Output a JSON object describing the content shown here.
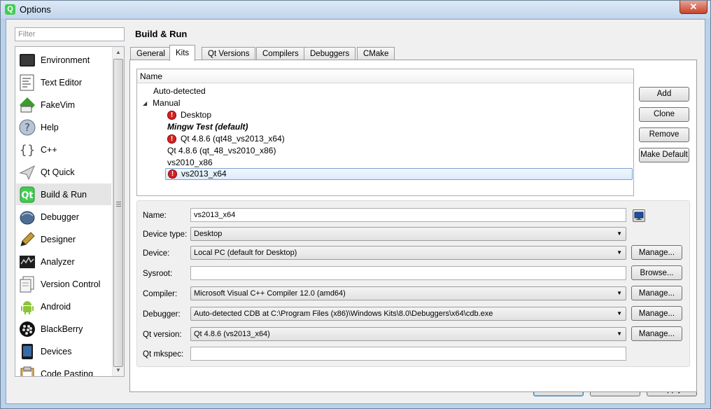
{
  "window": {
    "title": "Options",
    "app_icon_glyph": "Q",
    "close_glyph": "✕"
  },
  "filter": {
    "placeholder": "Filter",
    "value": ""
  },
  "categories": [
    {
      "label": "Environment",
      "icon": "environment-icon"
    },
    {
      "label": "Text Editor",
      "icon": "text-editor-icon"
    },
    {
      "label": "FakeVim",
      "icon": "fakevim-icon"
    },
    {
      "label": "Help",
      "icon": "help-icon"
    },
    {
      "label": "C++",
      "icon": "cpp-icon"
    },
    {
      "label": "Qt Quick",
      "icon": "qt-quick-icon"
    },
    {
      "label": "Build & Run",
      "icon": "build-run-icon",
      "selected": true
    },
    {
      "label": "Debugger",
      "icon": "debugger-icon"
    },
    {
      "label": "Designer",
      "icon": "designer-icon"
    },
    {
      "label": "Analyzer",
      "icon": "analyzer-icon"
    },
    {
      "label": "Version Control",
      "icon": "version-control-icon"
    },
    {
      "label": "Android",
      "icon": "android-icon"
    },
    {
      "label": "BlackBerry",
      "icon": "blackberry-icon"
    },
    {
      "label": "Devices",
      "icon": "devices-icon"
    },
    {
      "label": "Code Pasting",
      "icon": "code-pasting-icon"
    }
  ],
  "page": {
    "title": "Build & Run",
    "tabs": [
      "General",
      "Kits",
      "Qt Versions",
      "Compilers",
      "Debuggers",
      "CMake"
    ],
    "active_tab": "Kits"
  },
  "kits": {
    "header": "Name",
    "groups": {
      "auto_detected": "Auto-detected",
      "manual": "Manual"
    },
    "items": [
      {
        "label": "Desktop",
        "error": true
      },
      {
        "label": "Mingw Test (default)",
        "error": false,
        "default": true
      },
      {
        "label": "Qt 4.8.6 (qt48_vs2013_x64)",
        "error": true
      },
      {
        "label": "Qt 4.8.6 (qt_48_vs2010_x86)",
        "error": false
      },
      {
        "label": "vs2010_x86",
        "error": false
      },
      {
        "label": "vs2013_x64",
        "error": true,
        "selected": true
      }
    ],
    "buttons": {
      "add": "Add",
      "clone": "Clone",
      "remove": "Remove",
      "make_default": "Make Default"
    }
  },
  "form": {
    "name_label": "Name:",
    "name_value": "vs2013_x64",
    "device_type_label": "Device type:",
    "device_type_value": "Desktop",
    "device_label": "Device:",
    "device_value": "Local PC (default for Desktop)",
    "sysroot_label": "Sysroot:",
    "sysroot_value": "",
    "compiler_label": "Compiler:",
    "compiler_value": "Microsoft Visual C++ Compiler 12.0 (amd64)",
    "debugger_label": "Debugger:",
    "debugger_value": "Auto-detected CDB at C:\\Program Files (x86)\\Windows Kits\\8.0\\Debuggers\\x64\\cdb.exe",
    "qt_version_label": "Qt version:",
    "qt_version_value": "Qt 4.8.6 (vs2013_x64)",
    "mkspec_label": "Qt mkspec:",
    "mkspec_value": "",
    "manage_label": "Manage...",
    "browse_label": "Browse..."
  },
  "dialog": {
    "ok": "OK",
    "cancel": "Cancel",
    "apply": "Apply"
  },
  "colors": {
    "error": "#d42121",
    "selection": "#dcebfc",
    "window_frame": "#b9d1ea"
  }
}
